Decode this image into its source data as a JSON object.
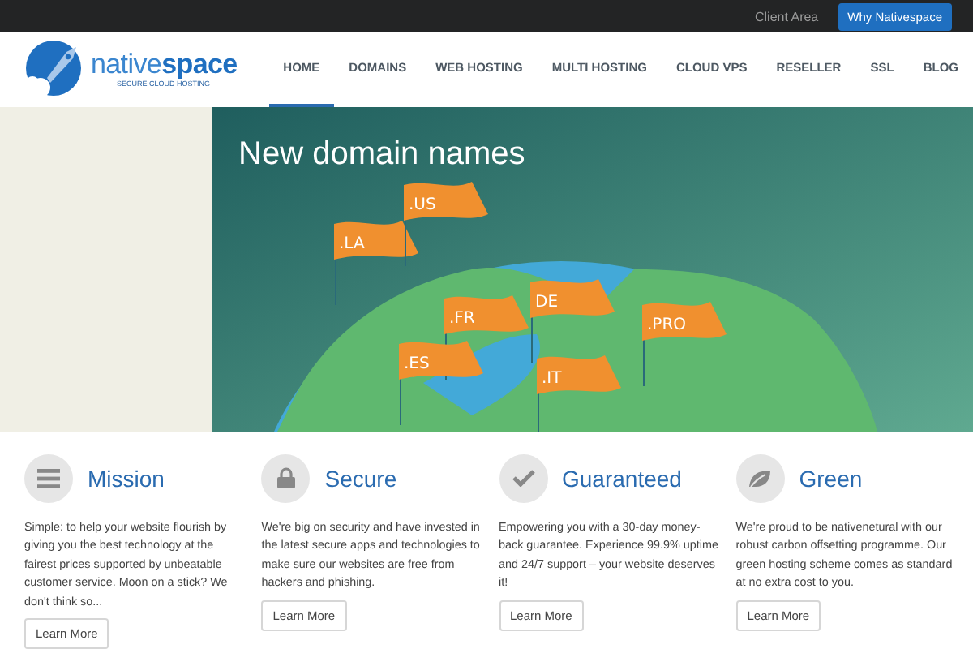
{
  "top_bar": {
    "link": "Client Area",
    "button": "Why Nativespace"
  },
  "logo": {
    "name_light": "native",
    "name_bold": "space",
    "tagline": "SECURE CLOUD HOSTING"
  },
  "nav": [
    {
      "label": "HOME",
      "selected": true
    },
    {
      "label": "DOMAINS",
      "selected": false
    },
    {
      "label": "WEB HOSTING",
      "selected": false
    },
    {
      "label": "MULTI HOSTING",
      "selected": false
    },
    {
      "label": "CLOUD VPS",
      "selected": false
    },
    {
      "label": "RESELLER",
      "selected": false
    },
    {
      "label": "SSL",
      "selected": false
    },
    {
      "label": "BLOG",
      "selected": false
    }
  ],
  "hero": {
    "title": "New domain names",
    "flags": [
      ".LA",
      ".US",
      ".FR",
      "DE",
      ".ES",
      ".IT",
      ".PRO"
    ]
  },
  "features": [
    {
      "kind": "menu",
      "title": "Mission",
      "text": "Simple: to help your website flourish by giving you the best technology at the fairest prices supported by unbeatable customer service. Moon on a stick? We don't think so...",
      "button": "Learn More"
    },
    {
      "kind": "lock",
      "title": "Secure",
      "text": "We're big on security and have invested in the latest secure apps and technologies to make sure our websites are free from hackers and phishing.",
      "button": "Learn More"
    },
    {
      "kind": "check",
      "title": "Guaranteed",
      "text": "Empowering you with a 30-day money-back guarantee. Experience 99.9% uptime and 24/7 support – your website deserves it!",
      "button": "Learn More"
    },
    {
      "kind": "leaf",
      "title": "Green",
      "text": "We're proud to be nativenetural with our robust carbon offsetting programme. Our green hosting scheme comes as standard at no extra cost to you.",
      "button": "Learn More"
    }
  ]
}
